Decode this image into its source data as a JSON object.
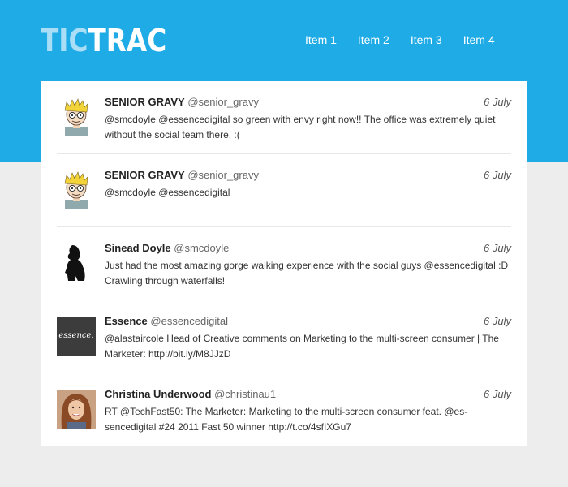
{
  "header": {
    "logo_tic": "TIC",
    "logo_trac": "TRAC",
    "nav": [
      "Item 1",
      "Item 2",
      "Item 3",
      "Item 4"
    ]
  },
  "tweets": [
    {
      "name": "SENIOR GRAVY",
      "handle": "@senior_gravy",
      "date": "6 July",
      "text": "@smcdoyle @essencedigital so green with envy right now!! The office was extremely quiet without the social team there. :(",
      "avatar": "cartoon-avatar"
    },
    {
      "name": "SENIOR GRAVY",
      "handle": "@senior_gravy",
      "date": "6 July",
      "text": "@smcdoyle @essencedigital",
      "avatar": "cartoon-avatar"
    },
    {
      "name": "Sinead Doyle",
      "handle": "@smcdoyle",
      "date": "6 July",
      "text": "Just had the most amazing gorge walking experience with the social guys @essencedigital :D Crawling through waterfalls!",
      "avatar": "silhouette-avatar"
    },
    {
      "name": "Essence",
      "handle": "@essencedigital",
      "date": "6 July",
      "text": "@alastaircole Head of Creative comments on Marketing to the multi-screen consumer | The Marketer: http://bit.ly/M8JJzD",
      "avatar": "essence-logo-avatar",
      "avatar_text": "essence."
    },
    {
      "name": "Christina Underwood",
      "handle": "@christinau1",
      "date": "6 July",
      "text": "RT @TechFast50: The Marketer: Marketing to the multi-screen consumer feat. @es-sencedigital #24 2011 Fast 50 winner http://t.co/4sfIXGu7",
      "avatar": "photo-avatar"
    }
  ],
  "colors": {
    "header_bg": "#1eabe6",
    "page_bg": "#ededed",
    "card_bg": "#ffffff",
    "logo_tic": "#a9def6"
  }
}
